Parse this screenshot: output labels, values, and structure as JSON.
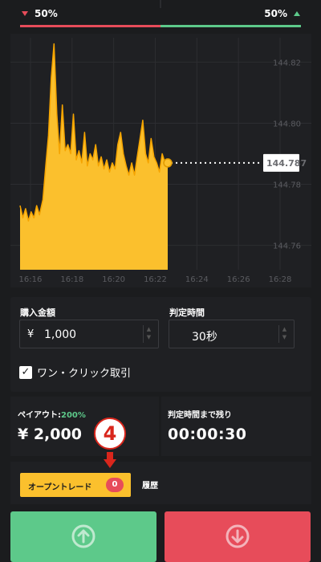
{
  "sentiment": {
    "low_pct": "50%",
    "high_pct": "50%",
    "low_share": 0.5,
    "high_share": 0.5
  },
  "chart": {
    "type": "area",
    "color": "#fbc02d",
    "current_price": "144.787",
    "y_ticks": [
      "144.82",
      "144.80",
      "144.78",
      "144.76"
    ],
    "x_ticks": [
      "16:16",
      "16:18",
      "16:20",
      "16:22",
      "16:24",
      "16:26",
      "16:28"
    ]
  },
  "chart_data": {
    "type": "area",
    "x_range": [
      "16:15:30",
      "16:28"
    ],
    "ylim": [
      144.752,
      144.828
    ],
    "series": [
      {
        "values": [
          [
            "16:15:30",
            144.773
          ],
          [
            "16:15:38",
            144.769
          ],
          [
            "16:15:46",
            144.772
          ],
          [
            "16:15:54",
            144.768
          ],
          [
            "16:16:02",
            144.771
          ],
          [
            "16:16:10",
            144.769
          ],
          [
            "16:16:18",
            144.773
          ],
          [
            "16:16:26",
            144.77
          ],
          [
            "16:16:36",
            144.775
          ],
          [
            "16:16:44",
            144.786
          ],
          [
            "16:16:52",
            144.796
          ],
          [
            "16:17:00",
            144.815
          ],
          [
            "16:17:08",
            144.826
          ],
          [
            "16:17:16",
            144.803
          ],
          [
            "16:17:24",
            144.79
          ],
          [
            "16:17:32",
            144.806
          ],
          [
            "16:17:40",
            144.791
          ],
          [
            "16:17:48",
            144.793
          ],
          [
            "16:17:56",
            144.79
          ],
          [
            "16:18:04",
            144.803
          ],
          [
            "16:18:12",
            144.788
          ],
          [
            "16:18:20",
            144.791
          ],
          [
            "16:18:28",
            144.787
          ],
          [
            "16:18:36",
            144.797
          ],
          [
            "16:18:44",
            144.786
          ],
          [
            "16:18:52",
            144.79
          ],
          [
            "16:19:00",
            144.788
          ],
          [
            "16:19:08",
            144.793
          ],
          [
            "16:19:16",
            144.786
          ],
          [
            "16:19:24",
            144.789
          ],
          [
            "16:19:32",
            144.785
          ],
          [
            "16:19:40",
            144.788
          ],
          [
            "16:19:48",
            144.784
          ],
          [
            "16:19:56",
            144.787
          ],
          [
            "16:20:04",
            144.785
          ],
          [
            "16:20:12",
            144.793
          ],
          [
            "16:20:20",
            144.797
          ],
          [
            "16:20:28",
            144.79
          ],
          [
            "16:20:36",
            144.786
          ],
          [
            "16:20:44",
            144.783
          ],
          [
            "16:20:52",
            144.787
          ],
          [
            "16:21:00",
            144.783
          ],
          [
            "16:21:08",
            144.789
          ],
          [
            "16:21:16",
            144.795
          ],
          [
            "16:21:24",
            144.801
          ],
          [
            "16:21:32",
            144.79
          ],
          [
            "16:21:40",
            144.787
          ],
          [
            "16:21:48",
            144.795
          ],
          [
            "16:21:56",
            144.789
          ],
          [
            "16:22:04",
            144.787
          ],
          [
            "16:22:12",
            144.784
          ],
          [
            "16:22:20",
            144.79
          ],
          [
            "16:22:28",
            144.787
          ],
          [
            "16:22:36",
            144.787
          ]
        ]
      }
    ]
  },
  "order": {
    "amount_label": "購入金額",
    "amount_currency": "¥",
    "amount_value": "1,000",
    "time_label": "判定時間",
    "time_value": "30秒",
    "one_click_label": "ワン・クリック取引",
    "one_click_checked": true
  },
  "payout": {
    "label": "ペイアウト:",
    "pct": "200%",
    "value": "¥ 2,000"
  },
  "remaining": {
    "label": "判定時間まで残り",
    "value": "00:00:30"
  },
  "annotation": {
    "step": "4"
  },
  "tabs": {
    "open_trade_label": "オープントレード",
    "open_trade_count": "0",
    "history_label": "履歴"
  },
  "buttons": {
    "high_icon": "arrow-up-circle-icon",
    "low_icon": "arrow-down-circle-icon",
    "high_color": "#5dc98a",
    "low_color": "#e74c5a"
  }
}
